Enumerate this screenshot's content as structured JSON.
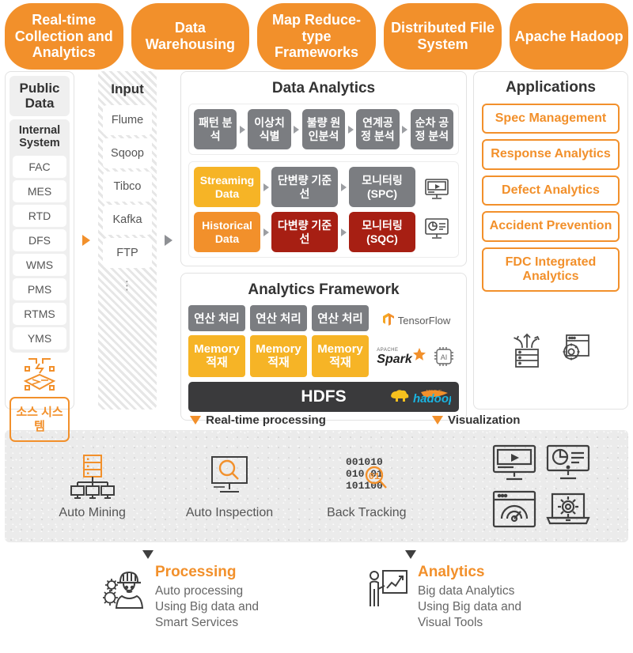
{
  "top_row": {
    "pills": [
      "Real-time Collection and Analytics",
      "Data Warehousing",
      "Map Reduce-type Frameworks",
      "Distributed File System",
      "Apache Hadoop"
    ]
  },
  "public_data": {
    "header": "Public Data",
    "internal_system_header": "Internal System",
    "items": [
      "FAC",
      "MES",
      "RTD",
      "DFS",
      "WMS",
      "PMS",
      "RTMS",
      "YMS"
    ],
    "source_system": "소스 시스템",
    "source_icon": "factory-network-icon"
  },
  "input": {
    "header": "Input",
    "items": [
      "Flume",
      "Sqoop",
      "Tibco",
      "Kafka",
      "FTP"
    ],
    "more": "⋮"
  },
  "data_analytics": {
    "title": "Data Analytics",
    "steps": [
      "패턴 분석",
      "이상치 식별",
      "불량 원인분석",
      "연계공정 분석",
      "순차 공정 분석"
    ]
  },
  "monitoring": {
    "row1": {
      "source": "Streaming Data",
      "baseline": "단변량 기준선",
      "monitor": "모니터링 (SPC)",
      "icon": "video-monitor-icon"
    },
    "row2": {
      "source": "Historical Data",
      "baseline": "다변량 기준선",
      "monitor": "모니터링 (SQC)",
      "icon": "chart-monitor-icon"
    }
  },
  "analytics_framework": {
    "title": "Analytics Framework",
    "compute_cells": [
      "연산 처리",
      "연산 처리",
      "연산 처리"
    ],
    "memory_cells": [
      "Memory 적재",
      "Memory 적재",
      "Memory 적재"
    ],
    "logos": {
      "tensorflow": "TensorFlow",
      "spark_apache": "APACHE",
      "spark": "Spark",
      "ai_chip": "AI"
    },
    "storage": "HDFS",
    "storage_logo": "hadoop"
  },
  "applications": {
    "title": "Applications",
    "items": [
      "Spec Management",
      "Response Analytics",
      "Defect Analytics",
      "Accident Prevention",
      "FDC Integrated Analytics"
    ],
    "icons": [
      "server-arrows-icon",
      "window-gear-icon"
    ]
  },
  "bands": {
    "realtime_label": "Real-time processing",
    "visualization_label": "Visualization",
    "realtime_items": [
      {
        "label": "Auto Mining",
        "icon": "server-network-icon"
      },
      {
        "label": "Auto Inspection",
        "icon": "monitor-magnifier-icon"
      },
      {
        "label": "Back Tracking",
        "icon": "binary-magnifier-icon"
      }
    ],
    "visualization_icons": [
      "video-monitor-icon",
      "pie-chart-monitor-icon",
      "gauge-window-icon",
      "laptop-gear-icon"
    ]
  },
  "footer": {
    "left": {
      "title": "Processing",
      "lines": [
        "Auto processing",
        "Using Big data and",
        "Smart Services"
      ],
      "icon": "worker-gears-icon"
    },
    "right": {
      "title": "Analytics",
      "lines": [
        "Big data Analytics",
        "Using Big data and",
        "Visual Tools"
      ],
      "icon": "presenter-chart-icon"
    }
  },
  "colors": {
    "orange": "#f2902b",
    "yellow": "#f6b426",
    "gray": "#7b7d81",
    "dark_red": "#a71f13",
    "dark": "#3a3a3c"
  }
}
